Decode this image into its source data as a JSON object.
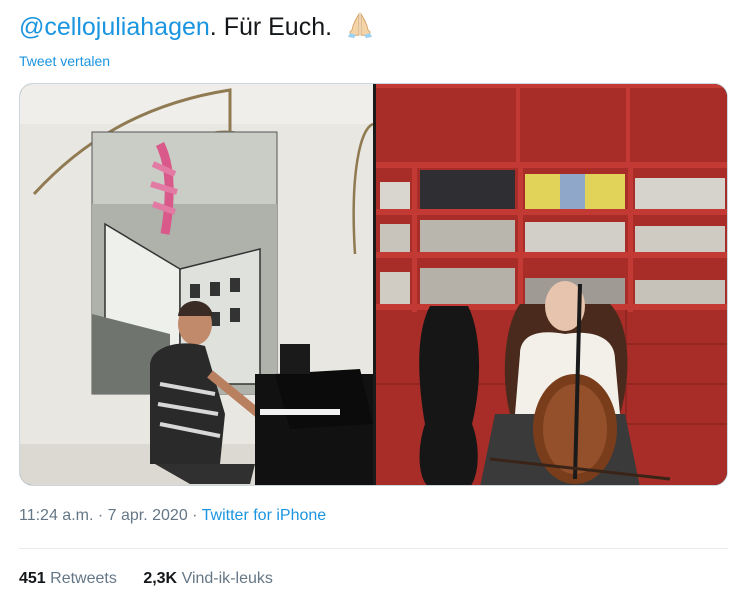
{
  "tweet": {
    "mention": "@cellojuliahagen",
    "text": ". Für Euch.",
    "emoji_icon": "folded-hands-icon",
    "translate_label": "Tweet vertalen"
  },
  "meta": {
    "time": "11:24 a.m.",
    "separator1": " · ",
    "date": "7 apr. 2020",
    "separator2": " · ",
    "source": "Twitter for iPhone"
  },
  "stats": {
    "retweets_count": "451",
    "retweets_label": "Retweets",
    "likes_count": "2,3K",
    "likes_label": "Vind-ik-leuks"
  },
  "colors": {
    "link": "#1b95e0",
    "secondary_text": "#657786",
    "shelf_red": "#b3312c"
  }
}
